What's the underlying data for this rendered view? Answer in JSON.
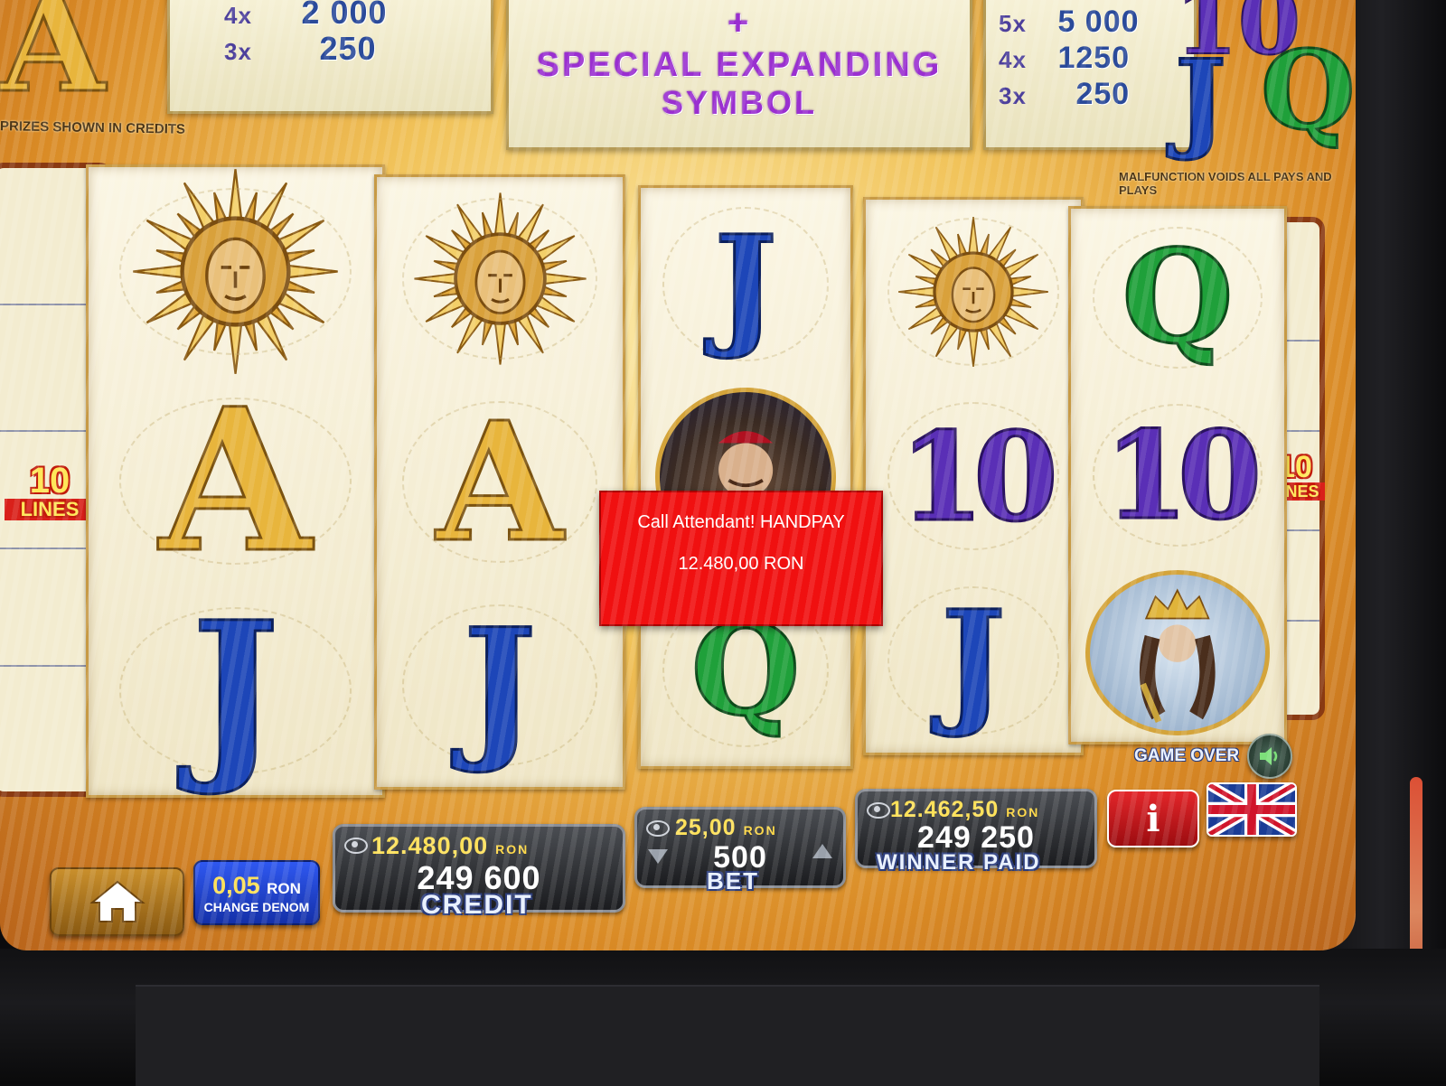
{
  "paytable": {
    "left_panel": [
      {
        "mult": "4x",
        "value": "2 000"
      },
      {
        "mult": "3x",
        "value": "250"
      }
    ],
    "left_letter": "A",
    "center_title": "+",
    "center_line1": "SPECIAL EXPANDING",
    "center_line2": "SYMBOL",
    "right_panel": [
      {
        "mult": "5x",
        "value": "5 000"
      },
      {
        "mult": "4x",
        "value": "1250"
      },
      {
        "mult": "3x",
        "value": "250"
      }
    ],
    "right_letters": [
      "10",
      "J",
      "Q"
    ],
    "prizes_note": "PRIZES SHOWN IN CREDITS",
    "malfunction_note": "MALFUNCTION VOIDS ALL PAYS AND PLAYS"
  },
  "lines": {
    "number": "10",
    "label": "LINES"
  },
  "reels": [
    [
      "sun",
      "A",
      "J"
    ],
    [
      "sun",
      "A",
      "J"
    ],
    [
      "J",
      "cardinal",
      "Q"
    ],
    [
      "sun",
      "10",
      "J"
    ],
    [
      "Q",
      "10",
      "king"
    ]
  ],
  "handpay": {
    "line1": "Call Attendant! HANDPAY",
    "line2": "12.480,00 RON"
  },
  "status": {
    "game_over": "GAME OVER"
  },
  "bottom_bar": {
    "denom": {
      "value": "0,05",
      "currency": "RON",
      "label": "CHANGE DENOM"
    },
    "credit": {
      "money": "12.480,00",
      "currency": "RON",
      "credits": "249 600",
      "label": "CREDIT"
    },
    "bet": {
      "money": "25,00",
      "currency": "RON",
      "credits": "500",
      "label": "BET"
    },
    "winner_paid": {
      "money": "12.462,50",
      "currency": "RON",
      "credits": "249 250",
      "label": "WINNER PAID"
    },
    "info_label": "i"
  },
  "colors": {
    "popup": "#f01010",
    "credit_money": "#ffe15a",
    "info_button": "#d4161a",
    "denom_button": "#1c3fd6"
  },
  "icons": [
    "home-icon",
    "speaker-icon",
    "uk-flag-icon",
    "eye-icon",
    "arrow-up-icon",
    "arrow-down-icon"
  ]
}
